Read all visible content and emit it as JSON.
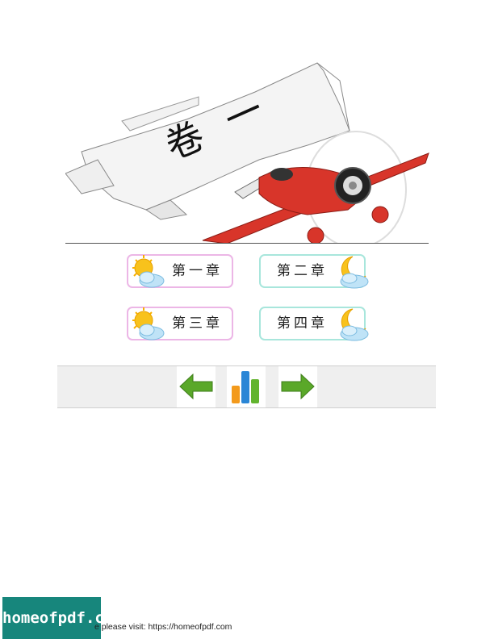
{
  "banner": {
    "title": "卷一"
  },
  "chapters": [
    {
      "label": "第一章",
      "icon": "sun-cloud-icon"
    },
    {
      "label": "第二章",
      "icon": "moon-cloud-icon"
    },
    {
      "label": "第三章",
      "icon": "sun-cloud-icon"
    },
    {
      "label": "第四章",
      "icon": "moon-cloud-icon"
    }
  ],
  "nav": {
    "prev_icon": "left-arrow-icon",
    "chart_icon": "bar-chart-icon",
    "next_icon": "right-arrow-icon"
  },
  "footer": {
    "logo": "homeofpdf.com",
    "text": "e please visit: https://homeofpdf.com"
  },
  "colors": {
    "sun_border": "#ecb6e6",
    "moon_border": "#a8e6dc",
    "arrow_green": "#5aa829",
    "plane_red": "#d8352a",
    "logo_bg": "#17867c"
  }
}
